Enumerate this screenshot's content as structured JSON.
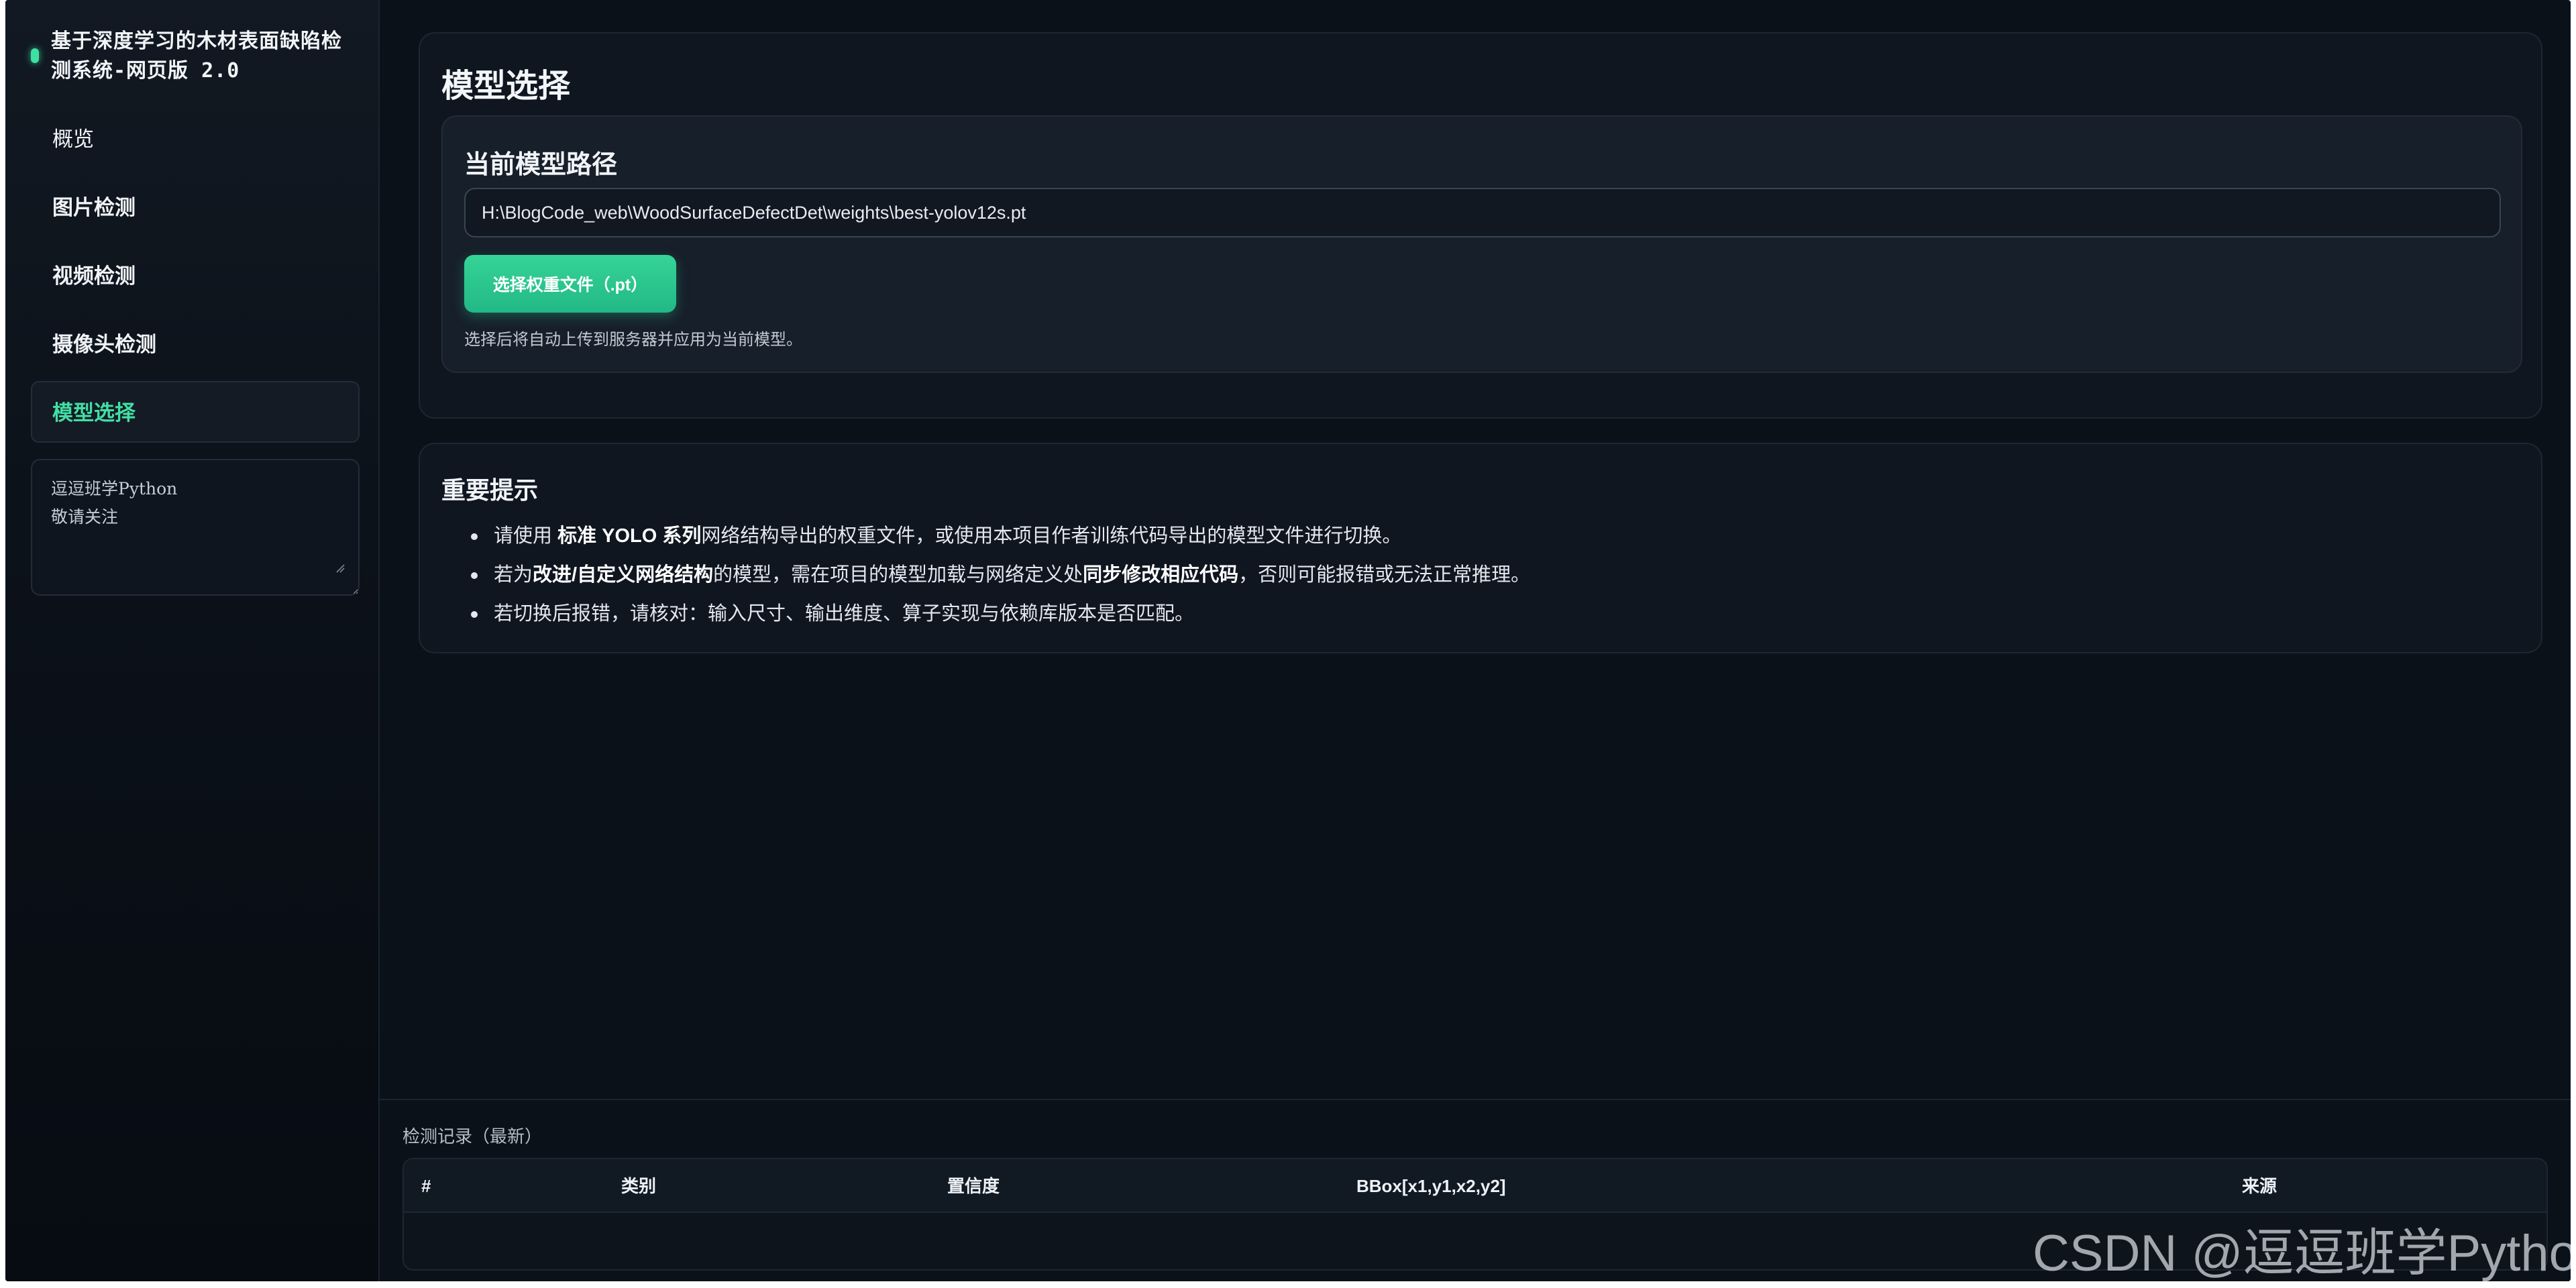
{
  "app": {
    "title": "基于深度学习的木材表面缺陷检测系统-网页版 2.0"
  },
  "sidebar": {
    "items": [
      {
        "label": "概览"
      },
      {
        "label": "图片检测"
      },
      {
        "label": "视频检测"
      },
      {
        "label": "摄像头检测"
      },
      {
        "label": "模型选择"
      }
    ],
    "active": "模型选择",
    "note_text": "逗逗班学Python\n敬请关注"
  },
  "model_select": {
    "title": "模型选择",
    "current_path_title": "当前模型路径",
    "path_value": "H:\\BlogCode_web\\WoodSurfaceDefectDet\\weights\\best-yolov12s.pt",
    "select_button": "选择权重文件（.pt）",
    "hint": "选择后将自动上传到服务器并应用为当前模型。"
  },
  "notice": {
    "title": "重要提示",
    "tip1": {
      "a": "请使用 ",
      "b": "标准 YOLO 系列",
      "c": "网络结构导出的权重文件，或使用本项目作者训练代码导出的模型文件进行切换。"
    },
    "tip2": {
      "a": "若为",
      "b": "改进/自定义网络结构",
      "c": "的模型，需在项目的模型加载与网络定义处",
      "d": "同步修改相应代码",
      "e": "，否则可能报错或无法正常推理。"
    },
    "tip3": "若切换后报错，请核对：输入尺寸、输出维度、算子实现与依赖库版本是否匹配。"
  },
  "records": {
    "title": "检测记录（最新）",
    "columns": [
      "#",
      "类别",
      "置信度",
      "BBox[x1,y1,x2,y2]",
      "来源"
    ],
    "rows": []
  },
  "watermark": "CSDN @逗逗班学Python",
  "colors": {
    "accent": "#42dfa4",
    "button": "#2bc58f",
    "background": "#0b1119"
  }
}
